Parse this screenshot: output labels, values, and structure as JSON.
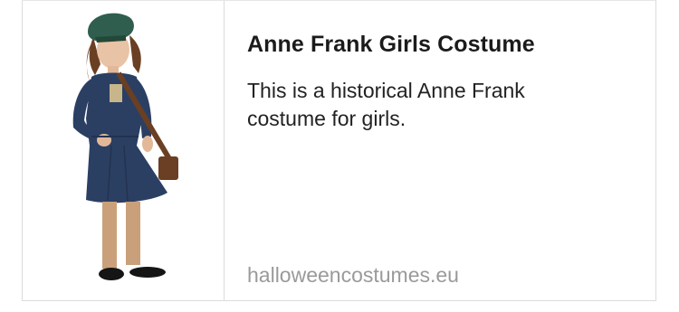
{
  "link_preview": {
    "title": "Anne Frank Girls Costume",
    "description": "This is a historical Anne Frank costume for girls.",
    "domain": "halloweencostumes.eu",
    "colors": {
      "title": "#1b1b1b",
      "description": "#222222",
      "domain": "#9a9a9a",
      "border": "#dcdcdc",
      "dress": "#2b3f63",
      "beret": "#2f5e4e",
      "bag": "#6a3f23",
      "tights": "#caa07b"
    },
    "image": {
      "subject": "girl-in-costume-photo"
    }
  }
}
